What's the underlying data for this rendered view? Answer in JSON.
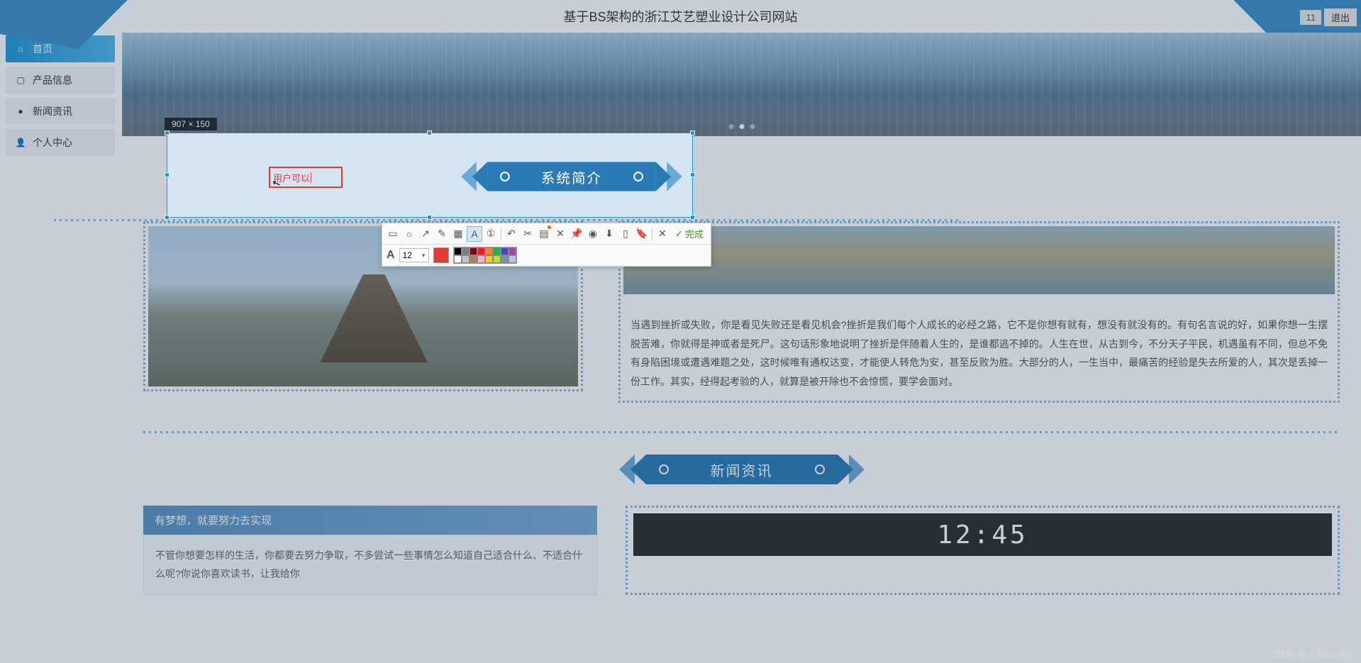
{
  "header": {
    "title": "基于BS架构的浙江艾艺塑业设计公司网站",
    "badge": "11",
    "logout": "退出"
  },
  "sidebar": {
    "items": [
      {
        "icon": "home-icon",
        "label": "首页",
        "active": true
      },
      {
        "icon": "cube-icon",
        "label": "产品信息",
        "active": false
      },
      {
        "icon": "info-icon",
        "label": "新闻资讯",
        "active": false
      },
      {
        "icon": "user-icon",
        "label": "个人中心",
        "active": false
      }
    ]
  },
  "sections": {
    "intro_title": "系统简介",
    "news_title": "新闻资讯"
  },
  "intro": {
    "text": "当遇到挫折或失败，你是看见失败还是看见机会?挫折是我们每个人成长的必经之路，它不是你想有就有，想没有就没有的。有句名言说的好，如果你想一生摆脱苦难，你就得是神或者是死尸。这句话形象地说明了挫折是伴随着人生的，是谁都逃不掉的。人生在世，从古到今，不分天子平民，机遇虽有不同，但总不免有身陷困境或遭遇难题之处，这时候唯有通权达变，才能使人转危为安，甚至反败为胜。大部分的人，一生当中，最痛苦的经验是失去所爱的人，其次是丢掉一份工作。其实，经得起考验的人，就算是被开除也不会惊慌，要学会面对。"
  },
  "news": {
    "card_title": "有梦想，就要努力去实现",
    "card_body": "不管你想要怎样的生活，你都要去努力争取，不多尝试一些事情怎么知道自己适合什么、不适合什么呢?你说你喜欢读书，让我给你"
  },
  "screenshot": {
    "dimensions": "907 × 150",
    "typed_text": "用户可以",
    "font_size": "12",
    "done_label": "完成",
    "colors_row1": [
      "#000000",
      "#7f7f7f",
      "#880015",
      "#ed1c24",
      "#ff7f27",
      "#22b14c",
      "#3f48cc",
      "#a349a4"
    ],
    "colors_row2": [
      "#ffffff",
      "#c3c3c3",
      "#b97a57",
      "#ffaec9",
      "#ffc90e",
      "#b5e61d",
      "#7092be",
      "#c8bfe7"
    ]
  },
  "watermark": "CSDN @小蔡coding"
}
